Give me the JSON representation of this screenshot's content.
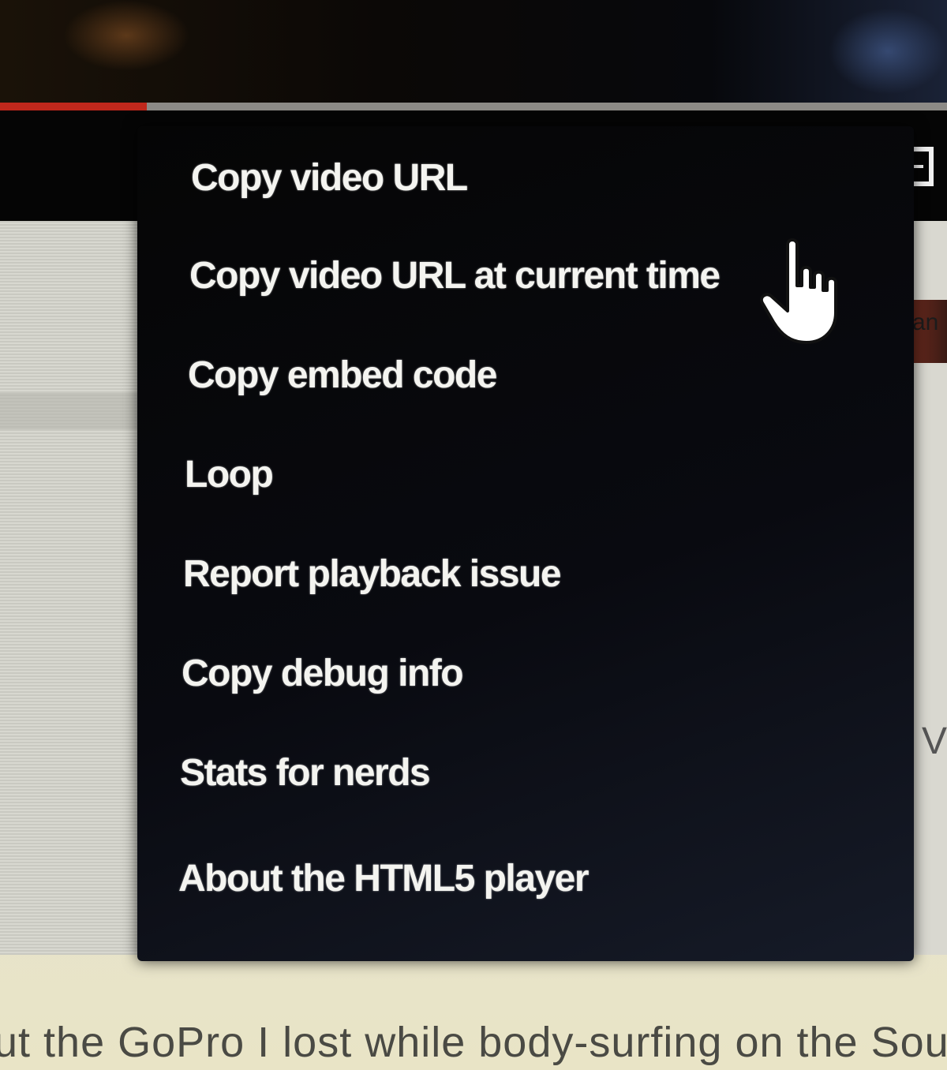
{
  "player": {
    "progress_fraction": 0.155,
    "colors": {
      "progress_fill": "#c0281c",
      "progress_track": "#8c8a86",
      "menu_background": "#050505",
      "menu_text": "#f4f4f0"
    },
    "icons": [
      "fullscreen-icon",
      "hand-pointer-cursor-icon"
    ]
  },
  "context_menu": {
    "items": [
      {
        "label": "Copy video URL"
      },
      {
        "label": "Copy video URL at current time"
      },
      {
        "label": "Copy embed code"
      },
      {
        "label": "Loop"
      },
      {
        "label": "Report playback issue"
      },
      {
        "label": "Copy debug info"
      },
      {
        "label": "Stats for nerds"
      },
      {
        "label": "About the HTML5 player"
      }
    ]
  },
  "page": {
    "description_snippet": "ut the GoPro I lost while body-surfing on the South Sh",
    "right_snippet_1": "an",
    "right_snippet_2": "V"
  }
}
